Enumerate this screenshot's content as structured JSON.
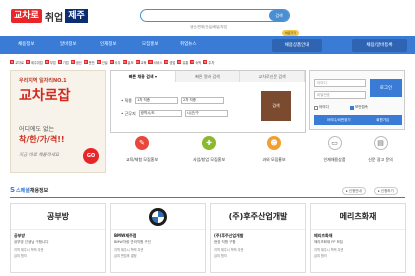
{
  "header": {
    "logo_box": "교차로",
    "logo_text": "취업",
    "logo_region": "제주",
    "search_button": "검색",
    "search_hint": "생산/판매/건설/배달/부업"
  },
  "nav": {
    "items": [
      "채용정보",
      "알바정보",
      "인재정보",
      "모집홍보",
      "취업뉴스"
    ],
    "badge": "바로가기",
    "right": [
      "채용상품안내",
      "채용/알바등록"
    ]
  },
  "adbar": {
    "chips": [
      "교차로",
      "제주취업",
      "부업",
      "기업",
      "생산",
      "운전",
      "건설",
      "사무",
      "홍보",
      "교육",
      "서비스",
      "영업",
      "유통",
      "숙박",
      "주차"
    ]
  },
  "banner": {
    "line1": "우리지역 일자리NO.1",
    "line2": "교차로잡",
    "line3": "어디에도 없는",
    "line4": "착/한/가/격!!",
    "line5": "지금 바로 채용하세요",
    "go": "GO"
  },
  "panel": {
    "tabs": [
      "빠른 채용 검색 ▾",
      "빠른 알바 검색",
      "교차로신문 검색"
    ],
    "row1_label": "• 직종",
    "row1_sel1": "1차 직종",
    "row1_sel2": "2차 직종",
    "row2_label": "• 근무지",
    "row2_sel1": "광역시/도",
    "row2_sel2": "시/군/구",
    "search_button": "검색"
  },
  "categories": [
    {
      "label": "교육/체험 모집홍보",
      "color": "#e8473a",
      "icon": "person-icon",
      "glyph": "✎"
    },
    {
      "label": "사업/창업 모집홍보",
      "color": "#8ab82e",
      "icon": "plus-icon",
      "glyph": "✚"
    },
    {
      "label": "과외 모집홍보",
      "color": "#f0a030",
      "icon": "user-icon",
      "glyph": "☻"
    }
  ],
  "login": {
    "id_placeholder": "아이디",
    "pw_placeholder": "비밀번호",
    "button": "로그인",
    "save_id": "아이디",
    "secure": "보안접속",
    "foot": [
      "아이디/비번찾기",
      "회원가입"
    ]
  },
  "side_links": [
    {
      "label": "인재채용상품",
      "icon": "monitor-icon",
      "glyph": "▭"
    },
    {
      "label": "신문 광고 문의",
      "icon": "paper-icon",
      "glyph": "▤"
    }
  ],
  "special": {
    "prefix": "S",
    "title_blue": "스페셜",
    "title_rest": "채용정보",
    "btns": [
      "▸ 신청안내",
      "▸ 신청하기"
    ]
  },
  "cards": [
    {
      "head": "공부방",
      "name": "공부방",
      "desc": "공부방 선생님 구합니다",
      "tags": "지역 제주시  학력 무관",
      "pay": "급여 협의"
    },
    {
      "head": "",
      "name": "BMW제주점",
      "desc": "BMW차량 관리직원 구인",
      "tags": "지역 제주시  학력 무관",
      "pay": "급여 면접후 결정"
    },
    {
      "head": "(주)후주산업개발",
      "name": "(주)후주산업개발",
      "desc": "현장 직원 구함",
      "tags": "지역 제주시  학력 무관",
      "pay": "급여 협의"
    },
    {
      "head": "메리츠화재",
      "name": "메리츠화재",
      "desc": "메리츠화재 FP 모집",
      "tags": "지역 제주시  학력 무관",
      "pay": "급여 협의"
    }
  ],
  "colors": {
    "primary": "#3a7bd5",
    "logo_red": "#e8262a",
    "jeju_navy": "#0c2d72",
    "panel_brown": "#7a4b2e"
  }
}
